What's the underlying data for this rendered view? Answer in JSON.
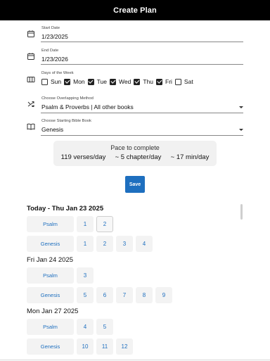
{
  "header": {
    "title": "Create Plan"
  },
  "form": {
    "start_date": {
      "label": "Start Date",
      "value": "1/23/2025",
      "icon": "calendar-icon"
    },
    "end_date": {
      "label": "End Date",
      "value": "1/23/2026",
      "icon": "calendar-icon"
    },
    "days_of_week": {
      "label": "Days of the Week",
      "icon": "view-week-icon",
      "days": [
        {
          "label": "Sun",
          "checked": false
        },
        {
          "label": "Mon",
          "checked": true
        },
        {
          "label": "Tue",
          "checked": true
        },
        {
          "label": "Wed",
          "checked": true
        },
        {
          "label": "Thu",
          "checked": true
        },
        {
          "label": "Fri",
          "checked": true
        },
        {
          "label": "Sat",
          "checked": false
        }
      ]
    },
    "overlap_method": {
      "label": "Choose Overlapping Method",
      "value": "Psalm & Proverbs | All other books",
      "icon": "shuffle-icon"
    },
    "starting_book": {
      "label": "Choose Starting Bible Book",
      "value": "Genesis",
      "icon": "book-icon"
    }
  },
  "pace": {
    "title": "Pace to complete",
    "verses": "119 verses/day",
    "chapters": "~ 5 chapter/day",
    "minutes": "~ 17 min/day"
  },
  "save_label": "Save",
  "schedule": [
    {
      "title": "Today - Thu Jan 23 2025",
      "rows": [
        {
          "book": "Psalm",
          "chapters": [
            "1",
            "2"
          ],
          "selected": "2"
        },
        {
          "book": "Genesis",
          "chapters": [
            "1",
            "2",
            "3",
            "4"
          ]
        }
      ]
    },
    {
      "title": "Fri Jan 24 2025",
      "rows": [
        {
          "book": "Psalm",
          "chapters": [
            "3"
          ]
        },
        {
          "book": "Genesis",
          "chapters": [
            "5",
            "6",
            "7",
            "8",
            "9"
          ]
        }
      ]
    },
    {
      "title": "Mon Jan 27 2025",
      "rows": [
        {
          "book": "Psalm",
          "chapters": [
            "4",
            "5"
          ]
        },
        {
          "book": "Genesis",
          "chapters": [
            "10",
            "11",
            "12"
          ]
        }
      ]
    }
  ]
}
